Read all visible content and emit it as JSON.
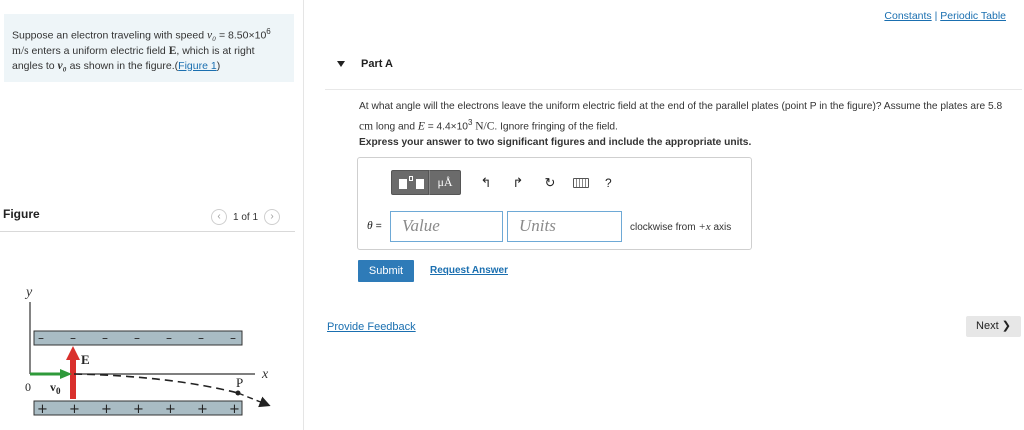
{
  "problem": {
    "text_1": "Suppose an electron traveling with speed",
    "v0": "v₀",
    "speed_value": "= 8.50×10",
    "speed_exp": "6",
    "unit": "m/s",
    "text_2": "enters a uniform electric field",
    "field_symbol": "E",
    "text_3": ", which is at right angles to",
    "text_4": "as shown in the figure.(",
    "figure_link": "Figure 1",
    "text_5": ")"
  },
  "figure": {
    "title": "Figure",
    "counter": "1 of 1",
    "prev_icon": "chevron-left-icon",
    "next_icon": "chevron-right-icon",
    "labels": {
      "y": "y",
      "x": "x",
      "origin": "0",
      "v0": "v",
      "v0_sub": "0",
      "e": "E",
      "p": "P",
      "minus": "–",
      "plus": "+"
    }
  },
  "top_links": {
    "constants": "Constants",
    "separator": " | ",
    "periodic": "Periodic Table"
  },
  "part": {
    "label": "Part A"
  },
  "question": {
    "q1": "At what angle will the electrons leave the uniform electric field at the end of the parallel plates (point P in the figure)? Assume the plates are 5.8",
    "q2_unit": "cm",
    "q2_text": "long and",
    "e_var": "E",
    "e_value": "= 4.4×10",
    "e_exp": "3",
    "e_unit": "N/C",
    "q2_end": ". Ignore fringing of the field."
  },
  "instruction": "Express your answer to two significant figures and include the appropriate units.",
  "toolbar": {
    "template_icon": "template-icon",
    "units_label": "μÅ",
    "undo_icon": "↰",
    "redo_icon": "↱",
    "reset_icon": "↻",
    "keyboard_icon": "keyboard-icon",
    "help_label": "?"
  },
  "answer": {
    "theta": "θ",
    "equals": " =",
    "value_placeholder": "Value",
    "units_placeholder": "Units",
    "suffix_text": "clockwise from",
    "suffix_axis": "+x",
    "suffix_end": "axis"
  },
  "buttons": {
    "submit": "Submit",
    "request_answer": "Request Answer",
    "provide_feedback": "Provide Feedback",
    "next": "Next ❯"
  },
  "colors": {
    "accent": "#2e7bb8",
    "link": "#1a6fb0",
    "problem_bg": "#eef5f8",
    "field_arrow": "#d9302c",
    "velocity_arrow": "#2f9a3a",
    "plate": "#a9bcc4"
  }
}
